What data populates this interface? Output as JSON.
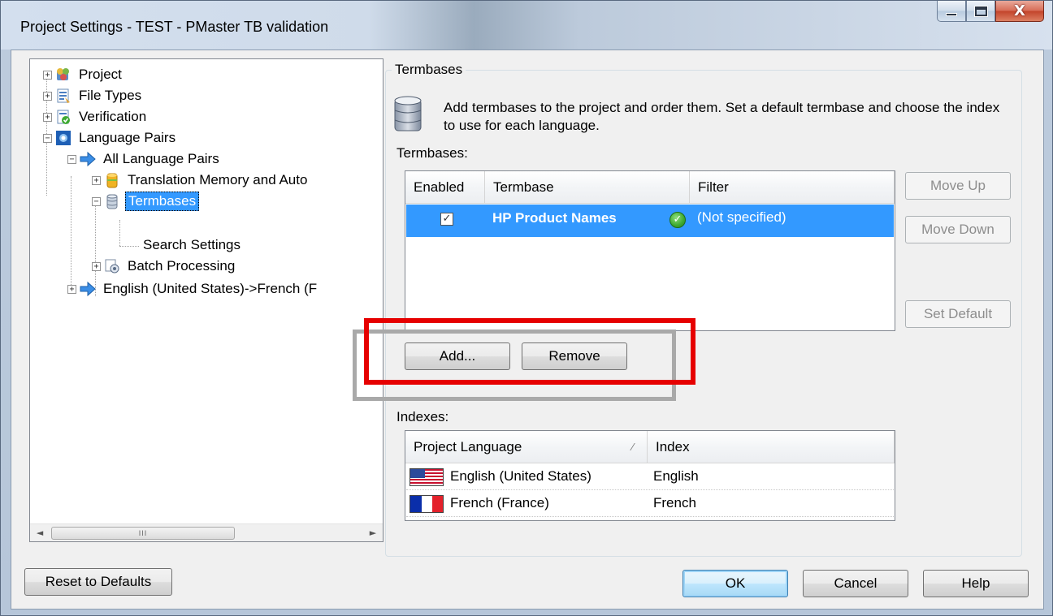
{
  "window": {
    "title": "Project Settings - TEST - PMaster TB validation",
    "close_glyph": "X"
  },
  "tree": {
    "items": [
      {
        "label": "Project",
        "toggle": "+"
      },
      {
        "label": "File Types",
        "toggle": "+"
      },
      {
        "label": "Verification",
        "toggle": "+"
      },
      {
        "label": "Language Pairs",
        "toggle": "−"
      },
      {
        "label": "All Language Pairs",
        "toggle": "−"
      },
      {
        "label": "Translation Memory and Auto",
        "toggle": "+"
      },
      {
        "label": "Termbases",
        "toggle": "−",
        "selected": true
      },
      {
        "label": "Search Settings",
        "toggle": ""
      },
      {
        "label": "Batch Processing",
        "toggle": "+"
      },
      {
        "label": "English (United States)->French (F",
        "toggle": "+"
      }
    ],
    "scroll_left": "◄",
    "scroll_thumb": "III",
    "scroll_right": "►"
  },
  "termbases_group": {
    "legend": "Termbases",
    "description": "Add termbases to the project and order them. Set a default termbase and choose the index to use for each language.",
    "list_label": "Termbases:",
    "columns": [
      "Enabled",
      "Termbase",
      "Filter"
    ],
    "rows": [
      {
        "enabled": "✓",
        "termbase": "HP Product Names",
        "filter": "(Not specified)"
      }
    ],
    "buttons": {
      "move_up": "Move Up",
      "move_down": "Move Down",
      "set_default": "Set Default",
      "add": "Add...",
      "remove": "Remove"
    }
  },
  "indexes": {
    "label": "Indexes:",
    "columns": [
      "Project Language",
      "Index"
    ],
    "sort_glyph": "⁄",
    "rows": [
      {
        "language": "English (United States)",
        "index": "English"
      },
      {
        "language": "French (France)",
        "index": "French"
      }
    ]
  },
  "footer": {
    "reset": "Reset to Defaults",
    "ok": "OK",
    "cancel": "Cancel",
    "help": "Help"
  },
  "colors": {
    "selection": "#3399ff",
    "annotation_red": "#e60000",
    "annotation_gray": "#a9a9a9"
  }
}
